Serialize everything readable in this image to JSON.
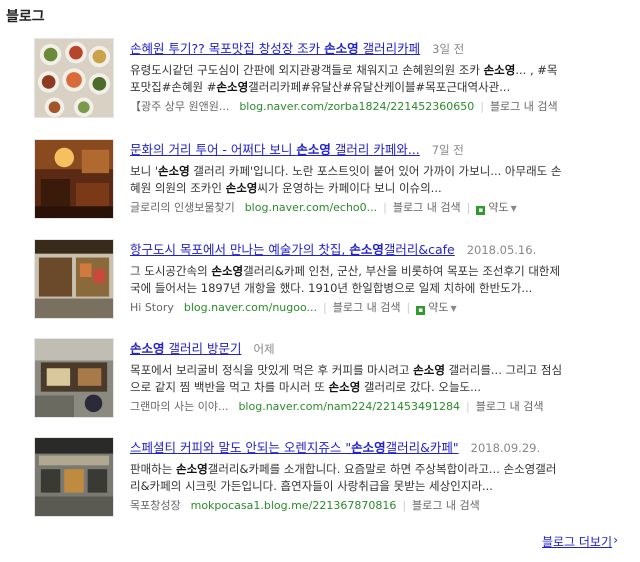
{
  "section": {
    "title": "블로그"
  },
  "items": [
    {
      "title_pre": "손혜원 투기?? 목포맛집 창성장 조카 ",
      "title_hl": "손소영",
      "title_post": " 갤러리카페",
      "date": "3일 전",
      "desc1_pre": "유령도시같던 구도심이 간판에 외지관광객들로 채워지고 손혜원의원 조카 ",
      "desc1_hl": "손소영",
      "desc1_post": "... , #목",
      "desc2_pre": "포맛집#손혜원 #",
      "desc2_hl": "손소영",
      "desc2_post": "갤러리카페#유달산#유달산케이블#목포근대역사관...",
      "source": "【광주 상무 원앤원...",
      "url": "blog.naver.com/zorba1824/221452360650",
      "inner": "블로그 내 검색"
    },
    {
      "title_pre": "문화의 거리 투어 - 어쩌다 보니 ",
      "title_hl": "손소영",
      "title_post": " 갤러리 카페와...",
      "date": "7일 전",
      "desc1_pre": "보니 '",
      "desc1_hl": "손소영",
      "desc1_post": " 갤러리 카페'입니다. 노란 포스트잇이 붙어 있어 가까이 가보니... 아무래도 손",
      "desc2_pre": "혜원 의원의 조카인 ",
      "desc2_hl": "손소영",
      "desc2_post": "씨가 운영하는 카페이다 보니 이슈의...",
      "source": "글로리의 인생보물찾기",
      "url": "blog.naver.com/echo0...",
      "inner": "블로그 내 검색",
      "translate": "약도"
    },
    {
      "title_pre": "항구도시 목포에서 만나는 예술가의 찻집, ",
      "title_hl": "손소영",
      "title_post": "갤러리&cafe",
      "date": "2018.05.16.",
      "desc1_pre": "그 도시공간속의 ",
      "desc1_hl": "손소영",
      "desc1_post": "갤러리&카페 인천, 군산, 부산을 비롯하여 목포는 조선후기 대한제",
      "desc2_pre": "국에 들어서는 1897년 개항을 했다. 1910년 한일합병으로 일제 치하에 한반도가...",
      "desc2_hl": "",
      "desc2_post": "",
      "source": "Hi Story",
      "url": "blog.naver.com/nugoo...",
      "inner": "블로그 내 검색",
      "translate": "약도"
    },
    {
      "title_pre": "",
      "title_hl": "손소영",
      "title_post": " 갤러리 방문기",
      "date": "어제",
      "desc1_pre": "목포에서 보리굴비 정식을 맛있게 먹은 후 커피를 마시려고 ",
      "desc1_hl": "손소영",
      "desc1_post": " 갤러리를... 그리고 점심",
      "desc2_pre": "으로 같지 찜 백반을 먹고 차를 마시러 또 ",
      "desc2_hl": "손소영",
      "desc2_post": " 갤러리로 갔다. 오늘도...",
      "source": "그랜마의 사는 이야...",
      "url": "blog.naver.com/nam224/221453491284",
      "inner": "블로그 내 검색"
    },
    {
      "title_pre": "스페셜티 커피와 말도 안되는 오렌지쥬스 \"",
      "title_hl": "손소영",
      "title_post": "갤러리&카페\"",
      "date": "2018.09.29.",
      "desc1_pre": "판매하는 ",
      "desc1_hl": "손소영",
      "desc1_post": "갤러리&카페를 소개합니다. 요즘말로 하면 주상복합이라고... 손소영갤러",
      "desc2_pre": "리&카페의 시크릿 가든입니다. 흡연자들이 사랑취급을 못받는 세상인지라...",
      "desc2_hl": "",
      "desc2_post": "",
      "source": "목포창성장",
      "url": "mokpocasa1.blog.me/221367870816",
      "inner": "블로그 내 검색"
    }
  ],
  "more": {
    "label": "블로그 더보기",
    "arrow": "›"
  },
  "colors": {
    "link": "#2222cc",
    "url": "#2a8a2a",
    "translate_icon": "#2f9a2f"
  },
  "icons": {
    "translate": "map-icon",
    "dropdown": "caret-down-icon"
  }
}
